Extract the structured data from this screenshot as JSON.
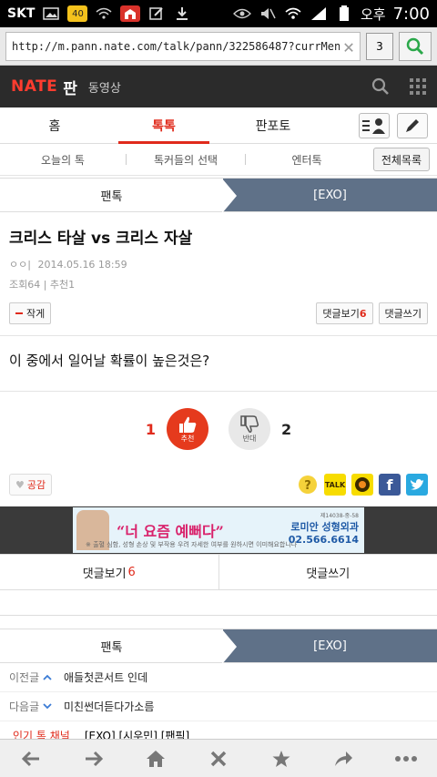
{
  "status_bar": {
    "carrier": "SKT",
    "badge_40": "40",
    "ampm": "오후",
    "time": "7:00"
  },
  "url_bar": {
    "url": "http://m.pann.nate.com/talk/pann/322586487?currMenu...",
    "tabs_count": "3"
  },
  "header": {
    "logo": "NATE",
    "section": "판",
    "video_link": "동영상"
  },
  "main_nav": {
    "items": [
      "홈",
      "톡톡",
      "판포토"
    ]
  },
  "sub_nav": {
    "items": [
      "오늘의 톡",
      "톡커들의 선택",
      "엔터톡"
    ],
    "all_list": "전체목록"
  },
  "breadcrumb": {
    "left": "팬톡",
    "right": "[EXO]"
  },
  "post": {
    "title": "크리스 타살 vs 크리스 자살",
    "author_mark": "ㅇㅇ|",
    "date": "2014.05.16 18:59",
    "views_recs": "조회64 | 추천1",
    "author_btn": "작게",
    "comment_view_label": "댓글보기",
    "comment_count": "6",
    "comment_write": "댓글쓰기",
    "body": "이 중에서 일어날 확률이 높은것은?"
  },
  "vote": {
    "up_count": "1",
    "up_label": "추천",
    "down_count": "2",
    "down_label": "반대"
  },
  "share": {
    "like_label": "공감",
    "kakao_label": "TALK"
  },
  "ad": {
    "slogan": "“너 요즘 예뻐다”",
    "brand": "로미안 성형외과",
    "phone": "02.566.6614",
    "license": "제14038-중-58",
    "small": "※ 출혈 심함, 성형 손상 및 부작용 우려 자세한 여부를 원하시면 이미해요합니다"
  },
  "comment_tabs": {
    "view_label": "댓글보기",
    "count": "6",
    "write_label": "댓글쓰기"
  },
  "list": {
    "prev_label": "이전글",
    "prev_title": "애들첫콘서트 인데",
    "next_label": "다음글",
    "next_title": "미친썬더듣다가소름",
    "hot_label": "인기 톡 채널",
    "hot_value": "[EXO] [시우민] [팬픽]"
  },
  "colors": {
    "accent": "#e02a1b",
    "crumb_blue": "#5f7188",
    "header_dark": "#2b2b2b"
  }
}
